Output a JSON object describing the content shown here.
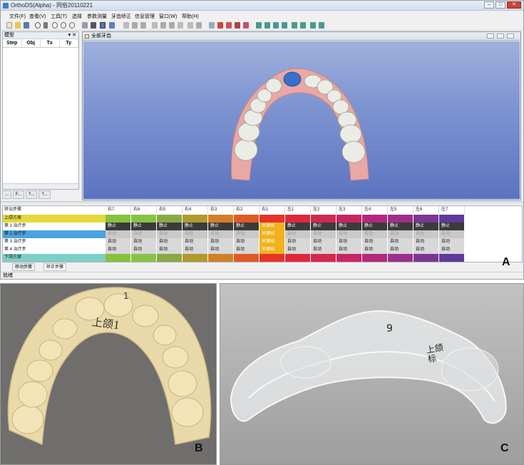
{
  "window": {
    "title": "OrthoDS(Alpha) - 同俗20110221",
    "min": "–",
    "max": "□",
    "close": "✕"
  },
  "menu": [
    "文件(F)",
    "查看(V)",
    "工具(T)",
    "选择",
    "参数测量",
    "牙齿矫正",
    "信息管理",
    "窗口(W)",
    "帮助(H)"
  ],
  "model_panel": {
    "title": "模型",
    "close": "▾ ✕",
    "columns": [
      "Step",
      "Obj",
      "Tx",
      "Ty"
    ],
    "tabs": [
      "...",
      "F...",
      "?...",
      "?..."
    ]
  },
  "view_window": {
    "title": "全部牙齿"
  },
  "grid": {
    "header_label": "矫治步骤",
    "teeth": [
      "右7",
      "右6",
      "右5",
      "右4",
      "右3",
      "右2",
      "右1",
      "左1",
      "左2",
      "左3",
      "左4",
      "左5",
      "左6",
      "左7"
    ],
    "tooth_colors": [
      "#85c23e",
      "#86c344",
      "#89a845",
      "#b09a2e",
      "#d27f27",
      "#e05a24",
      "#e6332a",
      "#e0283b",
      "#d32850",
      "#c82663",
      "#b4287a",
      "#9d2f8c",
      "#7d3595",
      "#5e3a9c"
    ],
    "upper_label": "上颌方案",
    "lower_label": "下颌方案",
    "rows": [
      {
        "label": "第 1 治疗步",
        "cells": [
          "静止",
          "静止",
          "静止",
          "静止",
          "静止",
          "静止",
          "关键帧",
          "静止",
          "静止",
          "静止",
          "静止",
          "静止",
          "静止",
          "静止"
        ],
        "style": "dark"
      },
      {
        "label": "第 2 治疗步",
        "cells": [
          "自动",
          "自动",
          "自动",
          "自动",
          "自动",
          "自动",
          "关键帧",
          "自动",
          "自动",
          "自动",
          "自动",
          "自动",
          "自动",
          "自动"
        ],
        "style": "selected"
      },
      {
        "label": "第 3 治疗步",
        "cells": [
          "自动",
          "自动",
          "自动",
          "自动",
          "自动",
          "自动",
          "关键帧",
          "自动",
          "自动",
          "自动",
          "自动",
          "自动",
          "自动",
          "自动"
        ],
        "style": "light"
      },
      {
        "label": "第 4 治疗步",
        "cells": [
          "自动",
          "自动",
          "自动",
          "自动",
          "自动",
          "自动",
          "关键帧",
          "自动",
          "自动",
          "自动",
          "自动",
          "自动",
          "自动",
          "自动"
        ],
        "style": "light"
      }
    ],
    "tabs": [
      "移动步骤",
      "矫正步骤"
    ]
  },
  "status": "就绪",
  "panel_labels": {
    "a": "A",
    "b": "B",
    "c": "C"
  },
  "photo_b": {
    "text1": "1",
    "text2": "上颌1"
  },
  "photo_c": {
    "text1": "9",
    "text2": "上颌\n标"
  }
}
